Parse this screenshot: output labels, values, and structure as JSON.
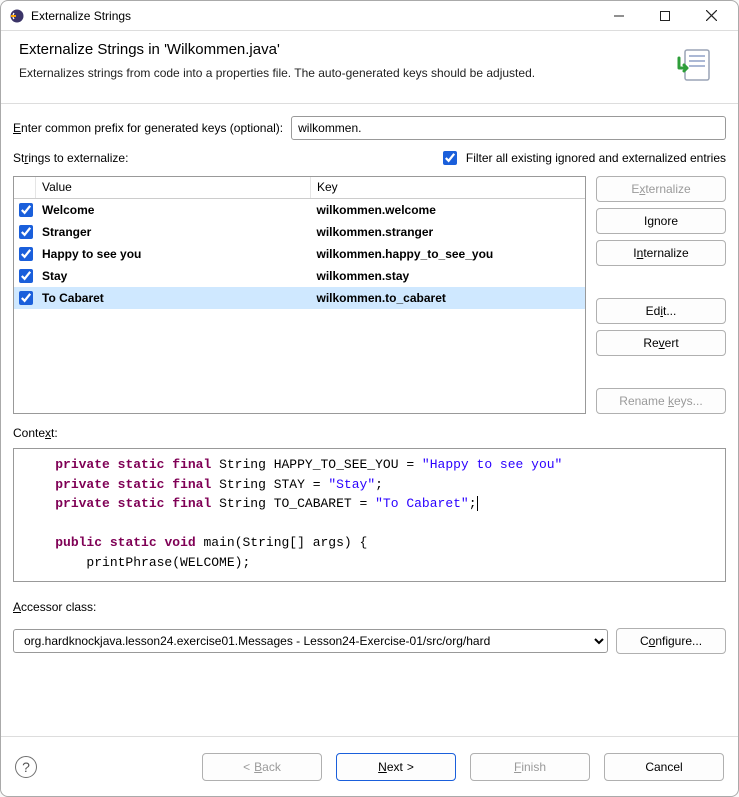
{
  "titlebar": {
    "title": "Externalize Strings"
  },
  "header": {
    "title": "Externalize Strings in 'Wilkommen.java'",
    "subtitle": "Externalizes strings from code into a properties file. The auto-generated keys should be adjusted."
  },
  "prefix": {
    "label_pre": "E",
    "label_post": "nter common prefix for generated keys (optional):",
    "value": "wilkommen."
  },
  "stringsLabel_pre": "St",
  "stringsLabel_und": "r",
  "stringsLabel_post": "ings to externalize:",
  "filter": {
    "checked": true,
    "label": "Filter all existing ignored and externalized entries"
  },
  "columns": {
    "value": "Value",
    "key": "Key"
  },
  "rows": [
    {
      "checked": true,
      "value": "Welcome",
      "key": "wilkommen.welcome",
      "selected": false
    },
    {
      "checked": true,
      "value": "Stranger",
      "key": "wilkommen.stranger",
      "selected": false
    },
    {
      "checked": true,
      "value": "Happy to see you",
      "key": "wilkommen.happy_to_see_you",
      "selected": false
    },
    {
      "checked": true,
      "value": "Stay",
      "key": "wilkommen.stay",
      "selected": false
    },
    {
      "checked": true,
      "value": "To Cabaret",
      "key": "wilkommen.to_cabaret",
      "selected": true
    }
  ],
  "sideButtons": {
    "externalize": "Externalize",
    "ignore": "Ignore",
    "internalize": "Internalize",
    "edit": "Edit...",
    "revert": "Revert",
    "rename": "Rename keys..."
  },
  "contextLabel": "Context:",
  "code": {
    "lines": [
      {
        "indent": "    ",
        "parts": [
          {
            "t": "private",
            "c": "kw"
          },
          {
            "t": " "
          },
          {
            "t": "static",
            "c": "kw"
          },
          {
            "t": " "
          },
          {
            "t": "final",
            "c": "kw"
          },
          {
            "t": " String HAPPY_TO_SEE_YOU = "
          },
          {
            "t": "\"Happy to see you\"",
            "c": "str"
          }
        ]
      },
      {
        "indent": "    ",
        "parts": [
          {
            "t": "private",
            "c": "kw"
          },
          {
            "t": " "
          },
          {
            "t": "static",
            "c": "kw"
          },
          {
            "t": " "
          },
          {
            "t": "final",
            "c": "kw"
          },
          {
            "t": " String STAY = "
          },
          {
            "t": "\"Stay\"",
            "c": "str"
          },
          {
            "t": ";"
          }
        ]
      },
      {
        "indent": "    ",
        "parts": [
          {
            "t": "private",
            "c": "kw"
          },
          {
            "t": " "
          },
          {
            "t": "static",
            "c": "kw"
          },
          {
            "t": " "
          },
          {
            "t": "final",
            "c": "kw"
          },
          {
            "t": " String TO_CABARET = "
          },
          {
            "t": "\"To Cabaret\"",
            "c": "str"
          },
          {
            "t": ";",
            "caret": true
          }
        ]
      },
      {
        "indent": "",
        "parts": []
      },
      {
        "indent": "    ",
        "parts": [
          {
            "t": "public",
            "c": "kw"
          },
          {
            "t": " "
          },
          {
            "t": "static",
            "c": "kw"
          },
          {
            "t": " "
          },
          {
            "t": "void",
            "c": "kw"
          },
          {
            "t": " main(String[] args) {"
          }
        ]
      },
      {
        "indent": "        ",
        "parts": [
          {
            "t": "printPhrase(WELCOME);"
          }
        ]
      }
    ]
  },
  "accessor": {
    "label_und": "A",
    "label_post": "ccessor class:",
    "value": "org.hardknockjava.lesson24.exercise01.Messages - Lesson24-Exercise-01/src/org/hard",
    "configure": "Configure..."
  },
  "footer": {
    "back": "Back",
    "next": "Next",
    "finish": "Finish",
    "cancel": "Cancel"
  }
}
